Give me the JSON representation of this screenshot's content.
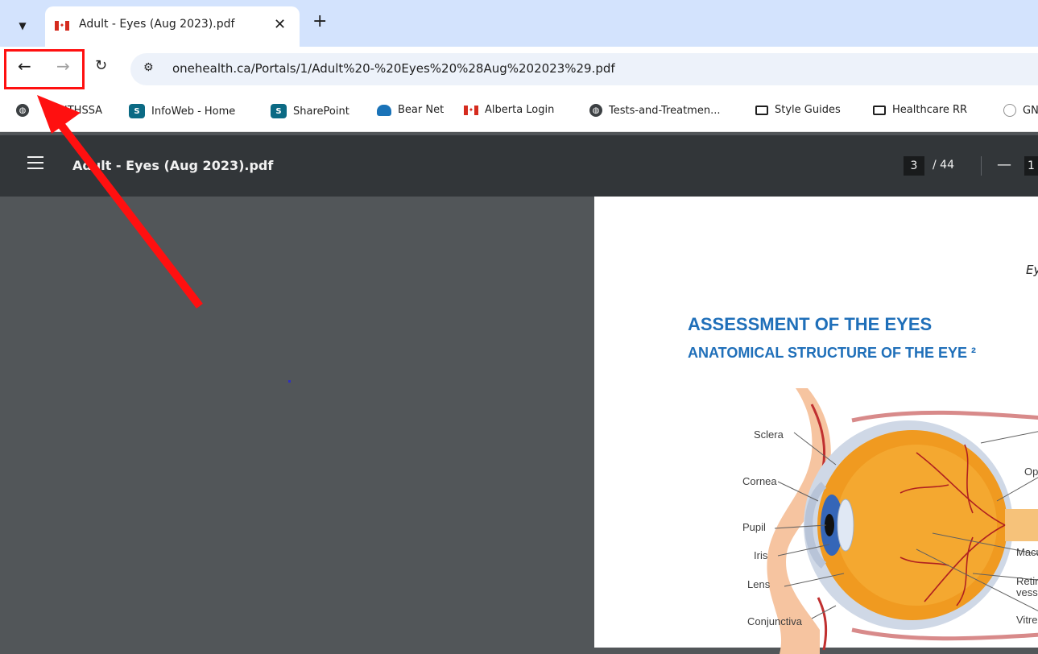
{
  "tab": {
    "title": "Adult - Eyes (Aug 2023).pdf"
  },
  "toolbar": {
    "url": "onehealth.ca/Portals/1/Adult%20-%20Eyes%20%28Aug%202023%29.pdf"
  },
  "bookmarks": [
    {
      "label": "NTHSSA",
      "icon": "globe-icon"
    },
    {
      "label": "InfoWeb - Home",
      "icon": "sharepoint-icon"
    },
    {
      "label": "SharePoint",
      "icon": "sharepoint-icon"
    },
    {
      "label": "Bear Net",
      "icon": "bear-icon"
    },
    {
      "label": "Alberta Login",
      "icon": "canada-flag-icon"
    },
    {
      "label": "Tests-and-Treatmen...",
      "icon": "globe-icon"
    },
    {
      "label": "Style Guides",
      "icon": "folder-icon"
    },
    {
      "label": "Healthcare RR",
      "icon": "folder-icon"
    },
    {
      "label": "GN",
      "icon": "globe-icon"
    }
  ],
  "pdf": {
    "title": "Adult - Eyes (Aug 2023).pdf",
    "current_page": "3",
    "total_pages": "/ 44",
    "zoom_value": "1"
  },
  "document": {
    "running_head": "Ey",
    "heading": "ASSESSMENT OF THE EYES",
    "subheading": "ANATOMICAL STRUCTURE OF THE EYE ²",
    "labels_left": [
      "Sclera",
      "Cornea",
      "Pupil",
      "Iris",
      "Lens",
      "Conjunctiva"
    ],
    "labels_right": [
      "Opt",
      "Macu",
      "Retin",
      "vess",
      "Vitre"
    ]
  },
  "colors": {
    "annotation": "#ff1010",
    "heading": "#1f6fb9"
  }
}
